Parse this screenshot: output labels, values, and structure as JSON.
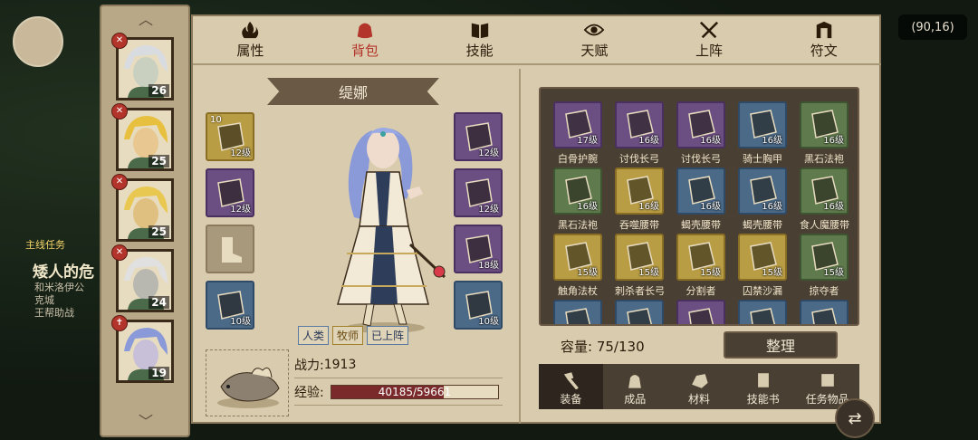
{
  "coords": "(90,16)",
  "background": {
    "quest_title": "主线任务",
    "quest_name": "矮人的危",
    "quest_desc": [
      "和米洛伊公",
      "克城",
      "王帮助战"
    ]
  },
  "heroes": [
    {
      "level": "26",
      "badge": "✕",
      "face_color": "#c9d0c0",
      "hair": "#d8dce0"
    },
    {
      "level": "25",
      "badge": "✕",
      "face_color": "#e8c890",
      "hair": "#e8c040"
    },
    {
      "level": "25",
      "badge": "✕",
      "face_color": "#e0c080",
      "hair": "#e8c850"
    },
    {
      "level": "24",
      "badge": "✕",
      "face_color": "#b8b8b0",
      "hair": "#e0e0e0"
    },
    {
      "level": "19",
      "badge": "✝",
      "face_color": "#c8c0d8",
      "hair": "#8a9ad8"
    }
  ],
  "tabs": [
    {
      "label": "属性",
      "icon": "flame-icon"
    },
    {
      "label": "背包",
      "icon": "bag-icon",
      "active": true
    },
    {
      "label": "技能",
      "icon": "book-icon"
    },
    {
      "label": "天赋",
      "icon": "eye-icon"
    },
    {
      "label": "上阵",
      "icon": "crossed-swords-icon"
    },
    {
      "label": "符文",
      "icon": "rune-icon"
    }
  ],
  "character": {
    "name": "缇娜",
    "tags": [
      "人类",
      "牧师",
      "已上阵"
    ],
    "power_label": "战力:",
    "power_value": "1913",
    "xp_label": "经验:",
    "xp_text": "40185/59661",
    "xp_fraction": 0.6735
  },
  "equipment": {
    "left": [
      {
        "quality": "gold",
        "level": "12级",
        "count": "10"
      },
      {
        "quality": "purple",
        "level": "12级"
      },
      {
        "quality": "empty",
        "level": ""
      },
      {
        "quality": "blue",
        "level": "10级"
      }
    ],
    "right": [
      {
        "quality": "purple",
        "level": "12级"
      },
      {
        "quality": "purple",
        "level": "12级"
      },
      {
        "quality": "purple",
        "level": "18级"
      },
      {
        "quality": "blue",
        "level": "10级"
      }
    ]
  },
  "inventory": {
    "items": [
      {
        "name": "白骨护腕",
        "level": "17级",
        "quality": "purple"
      },
      {
        "name": "讨伐长弓",
        "level": "16级",
        "quality": "purple"
      },
      {
        "name": "讨伐长弓",
        "level": "16级",
        "quality": "purple"
      },
      {
        "name": "骑士胸甲",
        "level": "16级",
        "quality": "blue"
      },
      {
        "name": "黑石法袍",
        "level": "16级",
        "quality": "green"
      },
      {
        "name": "黑石法袍",
        "level": "16级",
        "quality": "green"
      },
      {
        "name": "吞噬腰带",
        "level": "16级",
        "quality": "gold"
      },
      {
        "name": "蝎壳腰带",
        "level": "16级",
        "quality": "blue"
      },
      {
        "name": "蝎壳腰带",
        "level": "16级",
        "quality": "blue"
      },
      {
        "name": "食人魔腰带",
        "level": "16级",
        "quality": "green"
      },
      {
        "name": "触角法杖",
        "level": "15级",
        "quality": "gold"
      },
      {
        "name": "刺杀者长弓",
        "level": "15级",
        "quality": "gold"
      },
      {
        "name": "分割者",
        "level": "15级",
        "quality": "gold"
      },
      {
        "name": "囚禁沙漏",
        "level": "15级",
        "quality": "gold"
      },
      {
        "name": "掠夺者",
        "level": "15级",
        "quality": "green"
      },
      {
        "name": "",
        "level": "",
        "quality": "blue"
      },
      {
        "name": "",
        "level": "",
        "quality": "blue"
      },
      {
        "name": "",
        "level": "",
        "quality": "purple"
      },
      {
        "name": "",
        "level": "",
        "quality": "blue"
      },
      {
        "name": "",
        "level": "",
        "quality": "blue"
      }
    ],
    "capacity_label": "容量:",
    "capacity_value": "75/130",
    "organize_label": "整理"
  },
  "categories": [
    {
      "label": "装备",
      "icon": "hammer-icon",
      "active": true
    },
    {
      "label": "成品",
      "icon": "bag-icon"
    },
    {
      "label": "材料",
      "icon": "ore-icon"
    },
    {
      "label": "技能书",
      "icon": "scroll-icon"
    },
    {
      "label": "任务物品",
      "icon": "quest-scroll-icon"
    }
  ],
  "colors": {
    "gold": "#b99d45",
    "purple": "#6c4f82",
    "blue": "#4b6a88",
    "green": "#5f7a4c",
    "empty": "#a8987c",
    "accent_red": "#b3342a"
  }
}
